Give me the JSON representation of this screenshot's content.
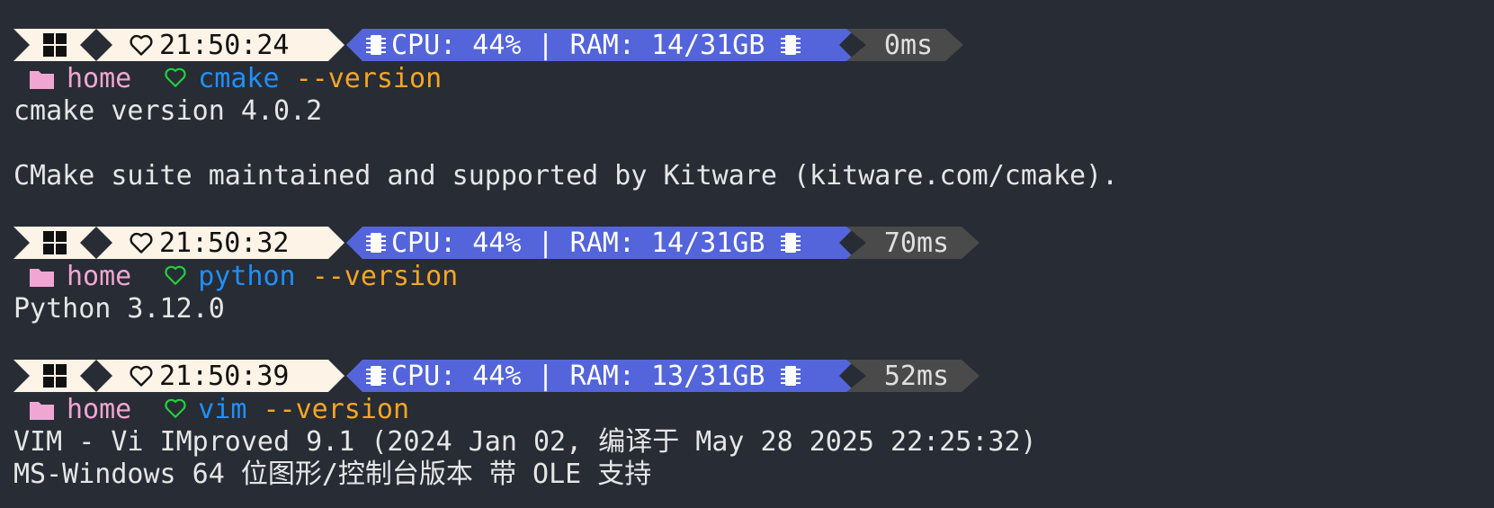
{
  "colors": {
    "background": "#282c34",
    "segment_light": "#fdf3e6",
    "segment_system": "#5465db",
    "segment_duration": "#4a4a4a",
    "directory": "#f0a6d3",
    "command": "#1e90ff",
    "argument": "#f5a623",
    "prompt_heart": "#22d13a",
    "output": "#e6e6e6"
  },
  "icons": {
    "os": "windows-logo-icon",
    "time": "heart-outline-icon",
    "system": "chip-icon",
    "directory": "folder-icon",
    "prompt": "heart-outline-icon"
  },
  "blocks": [
    {
      "time": "21:50:24",
      "system": "CPU: 44% | RAM: 14/31GB",
      "duration": "0ms",
      "dir": "home",
      "command": "cmake",
      "args": "--version",
      "output": [
        "cmake version 4.0.2",
        "",
        "CMake suite maintained and supported by Kitware (kitware.com/cmake).",
        ""
      ]
    },
    {
      "time": "21:50:32",
      "system": "CPU: 44% | RAM: 14/31GB",
      "duration": "70ms",
      "dir": "home",
      "command": "python",
      "args": "--version",
      "output": [
        "Python 3.12.0",
        ""
      ]
    },
    {
      "time": "21:50:39",
      "system": "CPU: 44% | RAM: 13/31GB",
      "duration": "52ms",
      "dir": "home",
      "command": "vim",
      "args": "--version",
      "output": [
        "VIM - Vi IMproved 9.1 (2024 Jan 02, 编译于 May 28 2025 22:25:32)",
        "MS-Windows 64 位图形/控制台版本 带 OLE 支持"
      ]
    }
  ]
}
